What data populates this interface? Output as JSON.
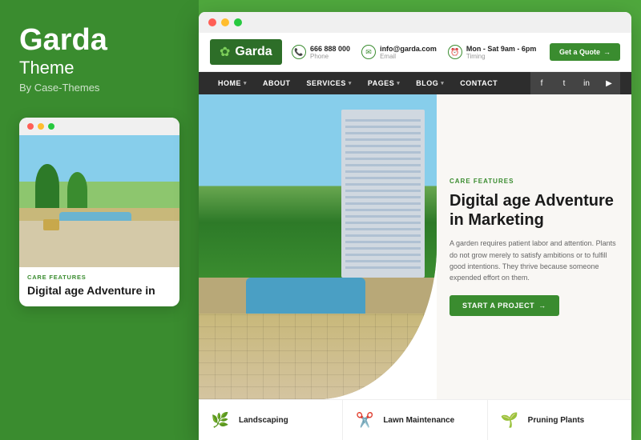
{
  "sidebar": {
    "logo_title": "Garda",
    "logo_subtitle": "Theme",
    "logo_by": "By Case-Themes",
    "browser_dots": [
      "red",
      "yellow",
      "green"
    ],
    "card_label": "CARE FEATURES",
    "card_title": "Digital age Adventure in"
  },
  "main_browser": {
    "dots": [
      "red",
      "yellow",
      "green"
    ],
    "header": {
      "logo_text": "Garda",
      "phone_label": "Phone",
      "phone_value": "666 888 000",
      "email_label": "Email",
      "email_value": "info@garda.com",
      "timing_label": "Timing",
      "timing_value": "Mon - Sat 9am - 6pm",
      "cta_label": "Get a Quote"
    },
    "nav": {
      "items": [
        {
          "label": "HOME",
          "has_dropdown": true
        },
        {
          "label": "ABOUT",
          "has_dropdown": false
        },
        {
          "label": "SERVICES",
          "has_dropdown": true
        },
        {
          "label": "PAGES",
          "has_dropdown": true
        },
        {
          "label": "BLOG",
          "has_dropdown": true
        },
        {
          "label": "CONTACT",
          "has_dropdown": false
        }
      ],
      "social": [
        "f",
        "t",
        "in",
        "▶"
      ]
    },
    "hero": {
      "category": "CARE FEATURES",
      "title": "Digital age Adventure in Marketing",
      "description": "A garden requires patient labor and attention. Plants do not grow merely to satisfy ambitions or to fulfill good intentions. They thrive because someone expended effort on them.",
      "btn_label": "START A PROJECT"
    },
    "services": [
      {
        "icon": "🌿",
        "label": "Landscaping"
      },
      {
        "icon": "✂️",
        "label": "Lawn Maintenance"
      },
      {
        "icon": "🌱",
        "label": "Pruning Plants"
      }
    ]
  }
}
